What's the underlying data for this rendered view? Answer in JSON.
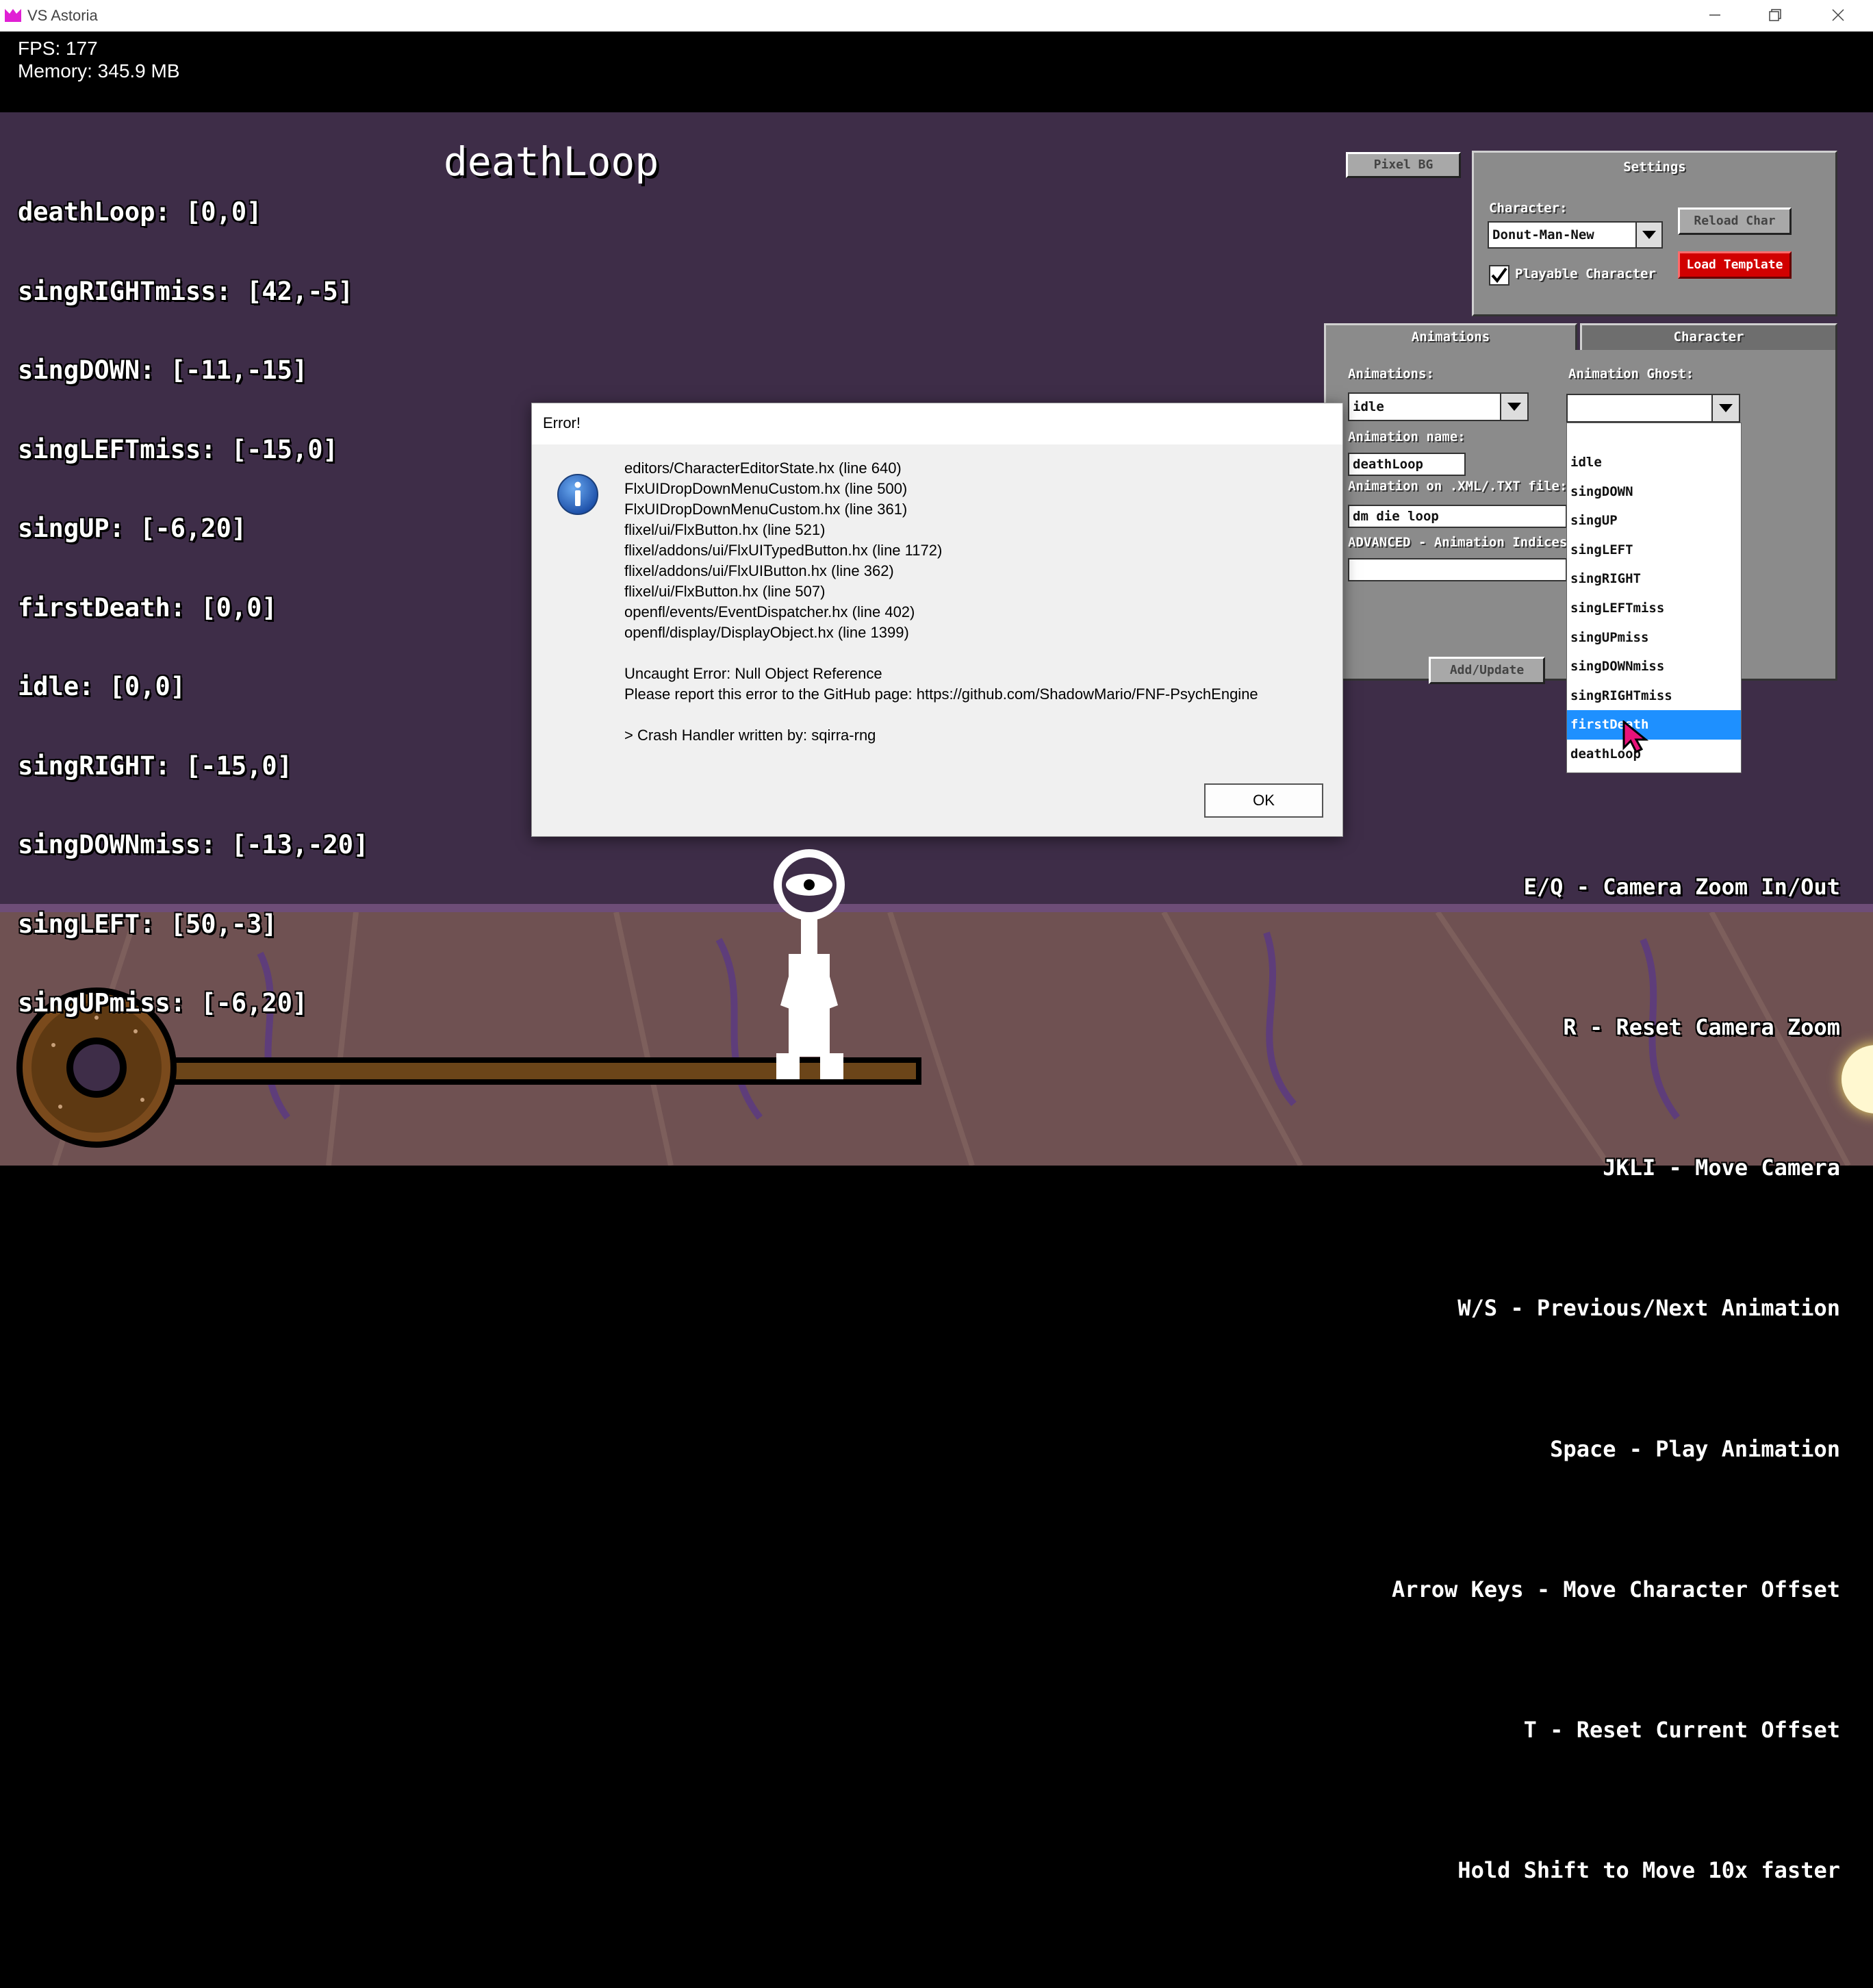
{
  "window": {
    "title": "VS Astoria",
    "minimize_icon": "minimize-icon",
    "restore_icon": "restore-icon",
    "close_icon": "close-icon"
  },
  "stats": {
    "fps": "FPS: 177",
    "memory": "Memory: 345.9 MB"
  },
  "offsets": [
    "deathLoop: [0,0]",
    "singRIGHTmiss: [42,-5]",
    "singDOWN: [-11,-15]",
    "singLEFTmiss: [-15,0]",
    "singUP: [-6,20]",
    "firstDeath: [0,0]",
    "idle: [0,0]",
    "singRIGHT: [-15,0]",
    "singDOWNmiss: [-13,-20]",
    "singLEFT: [50,-3]",
    "singUPmiss: [-6,20]"
  ],
  "current_animation": "deathLoop",
  "editor": {
    "pixel_bg_button": "Pixel BG",
    "settings": {
      "header": "Settings",
      "character_label": "Character:",
      "character_value": "Donut-Man-New",
      "reload_button": "Reload Char",
      "load_template_button": "Load Template",
      "playable_label": "Playable Character",
      "playable_checked": true
    },
    "tabs": {
      "animations": "Animations",
      "character": "Character"
    },
    "animations": {
      "animations_label": "Animations:",
      "animations_value": "idle",
      "ghost_label": "Animation Ghost:",
      "ghost_value": "",
      "name_label": "Animation name:",
      "name_value": "deathLoop",
      "xml_label": "Animation on .XML/.TXT file:",
      "xml_value": "dm die loop",
      "indices_label": "ADVANCED - Animation Indices",
      "indices_value": "",
      "add_update_button": "Add/Update"
    },
    "ghost_dropdown_items": [
      "idle",
      "singDOWN",
      "singUP",
      "singLEFT",
      "singRIGHT",
      "singLEFTmiss",
      "singUPmiss",
      "singDOWNmiss",
      "singRIGHTmiss",
      "firstDeath",
      "deathLoop"
    ],
    "ghost_dropdown_highlighted": "firstDeath"
  },
  "controls_help": [
    "E/Q - Camera Zoom In/Out",
    "R - Reset Camera Zoom",
    "JKLI - Move Camera",
    "W/S - Previous/Next Animation",
    "Space - Play Animation",
    "Arrow Keys - Move Character Offset",
    "T - Reset Current Offset",
    "Hold Shift to Move 10x faster"
  ],
  "error_dialog": {
    "title": "Error!",
    "icon": "info-icon",
    "stack": [
      "editors/CharacterEditorState.hx (line 640)",
      "FlxUIDropDownMenuCustom.hx (line 500)",
      "FlxUIDropDownMenuCustom.hx (line 361)",
      "flixel/ui/FlxButton.hx (line 521)",
      "flixel/addons/ui/FlxUITypedButton.hx (line 1172)",
      "flixel/addons/ui/FlxUIButton.hx (line 362)",
      "flixel/ui/FlxButton.hx (line 507)",
      "openfl/events/EventDispatcher.hx (line 402)",
      "openfl/display/DisplayObject.hx (line 1399)"
    ],
    "error": "Uncaught Error: Null Object Reference",
    "report": "Please report this error to the GitHub page: https://github.com/ShadowMario/FNF-PsychEngine",
    "credit": "> Crash Handler written by: sqirra-rng",
    "ok_button": "OK"
  }
}
